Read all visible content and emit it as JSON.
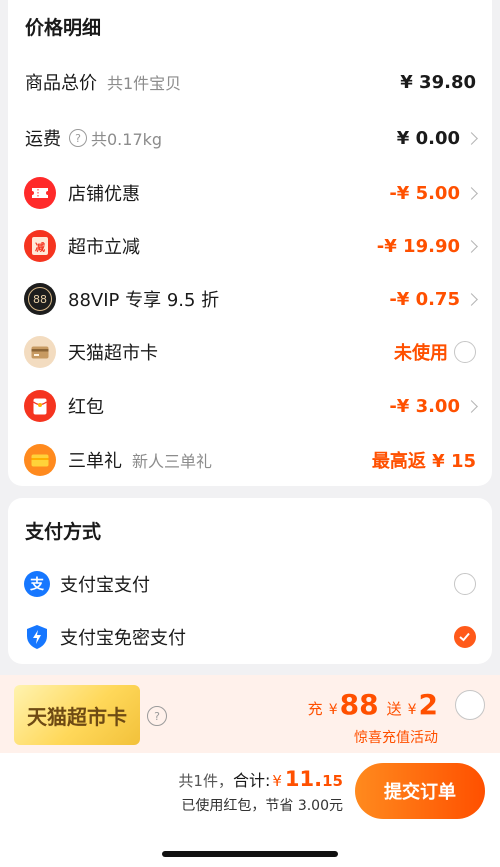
{
  "price_detail": {
    "title": "价格明细",
    "goods_total": {
      "label": "商品总价",
      "sub": "共1件宝贝",
      "value": "¥ 39.80"
    },
    "shipping": {
      "label": "运费",
      "sub": "共0.17kg",
      "value": "¥ 0.00"
    },
    "discounts": [
      {
        "label": "店铺优惠",
        "value": "-¥ 5.00",
        "icon": "coupon-icon",
        "color": "#ff2a2a"
      },
      {
        "label": "超市立减",
        "value": "-¥ 19.90",
        "icon": "reduction-icon",
        "color": "#f5341f"
      },
      {
        "label": "88VIP 专享 9.5 折",
        "value": "-¥ 0.75",
        "icon": "88vip-icon",
        "color": "#1d1d1d"
      },
      {
        "label": "天猫超市卡",
        "value": "未使用",
        "icon": "card-icon",
        "color": "#e7c7a0"
      },
      {
        "label": "红包",
        "value": "-¥ 3.00",
        "icon": "red-packet-icon",
        "color": "#f5341f"
      },
      {
        "label": "三单礼",
        "sub": "新人三单礼",
        "value": "最高返 ¥ 15",
        "icon": "gift-icon",
        "color": "#ff8a1e"
      }
    ],
    "vip_icon_text": "88",
    "reduction_icon_text": "减"
  },
  "payment": {
    "title": "支付方式",
    "options": [
      {
        "label": "支付宝支付",
        "icon": "alipay-icon",
        "selected": false
      },
      {
        "label": "支付宝免密支付",
        "icon": "alipay-shield-icon",
        "selected": true
      }
    ],
    "alipay_glyph": "支"
  },
  "promo": {
    "card_text": "天猫超市卡",
    "recharge_prefix": "充",
    "currency": "¥",
    "recharge_amount": "88",
    "bonus_prefix": "送",
    "bonus_amount": "2",
    "subtitle": "惊喜充值活动"
  },
  "footer": {
    "count": "共1件，",
    "total_label": "合计:",
    "currency": "¥",
    "total_int": "11.",
    "total_dec": "15",
    "savings": "已使用红包，节省 3.00元",
    "submit": "提交订单"
  },
  "colors": {
    "accent": "#ff5000",
    "page_bg": "#f1f1f3"
  }
}
